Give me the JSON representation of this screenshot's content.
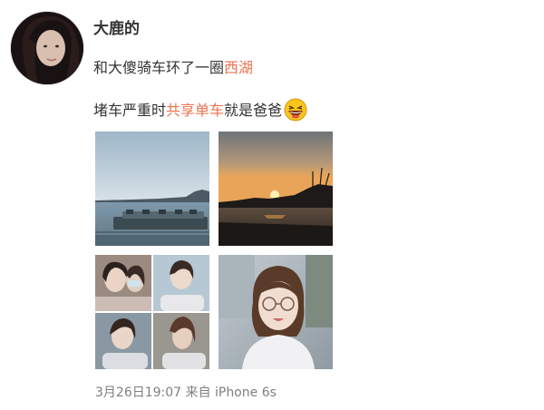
{
  "post": {
    "username": "大鹿的",
    "line1_text": "和大傻骑车环了一圈",
    "line1_link": "西湖",
    "line2_pre": "堵车严重时",
    "line2_link": "共享单车",
    "line2_post": "就是爸爸",
    "emoji": "laughing-emoji",
    "timestamp": "3月26日19:07",
    "source": "来自 iPhone 6s"
  },
  "colors": {
    "link": "#eb7350",
    "text": "#333333",
    "meta": "#808080"
  }
}
